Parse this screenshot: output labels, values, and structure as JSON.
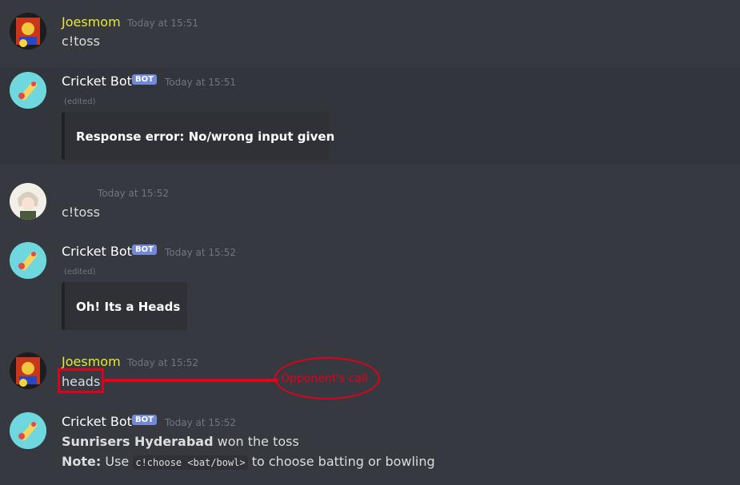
{
  "messages": [
    {
      "author": "Joesmom",
      "author_color": "#e9e92e",
      "time": "Today at 15:51",
      "content": "c!toss"
    },
    {
      "author": "Cricket Bot",
      "badge": "BOT",
      "time": "Today at 15:51",
      "edited": "(edited)",
      "embed": "Response error: No/wrong input given"
    },
    {
      "author": "",
      "time": "Today at 15:52",
      "content": "c!toss"
    },
    {
      "author": "Cricket Bot",
      "badge": "BOT",
      "time": "Today at 15:52",
      "edited": "(edited)",
      "embed": "Oh! Its a Heads"
    },
    {
      "author": "Joesmom",
      "author_color": "#e9e92e",
      "time": "Today at 15:52",
      "content": "heads"
    },
    {
      "author": "Cricket Bot",
      "badge": "BOT",
      "time": "Today at 15:52",
      "line1_bold": "Sunrisers Hyderabad",
      "line1_rest": "won the toss",
      "line2_bold": "Note:",
      "line2_pre": "Use",
      "line2_code": "c!choose <bat/bowl>",
      "line2_post": "to choose batting or bowling"
    }
  ],
  "annotation": {
    "label": "Opponent's call",
    "color": "#e2001a"
  },
  "colors": {
    "background": "#36393f",
    "bot_badge": "#7289da",
    "embed_bg": "#2f3136"
  }
}
